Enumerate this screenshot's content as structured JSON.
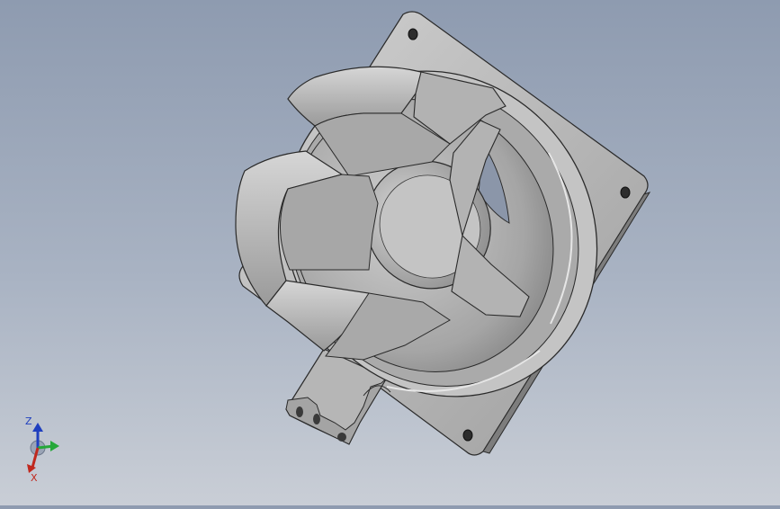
{
  "viewport": {
    "background_top": "#8e9bb0",
    "background_bottom": "#c9ced6",
    "model": "axial-fan-housing",
    "model_color": "#b9b9b9",
    "edge_color": "#2a2a2a"
  },
  "triad": {
    "z_label": "Z",
    "x_label": "X",
    "z_color": "#1f3fbf",
    "x_color": "#c0281e",
    "y_color": "#25a83a"
  }
}
